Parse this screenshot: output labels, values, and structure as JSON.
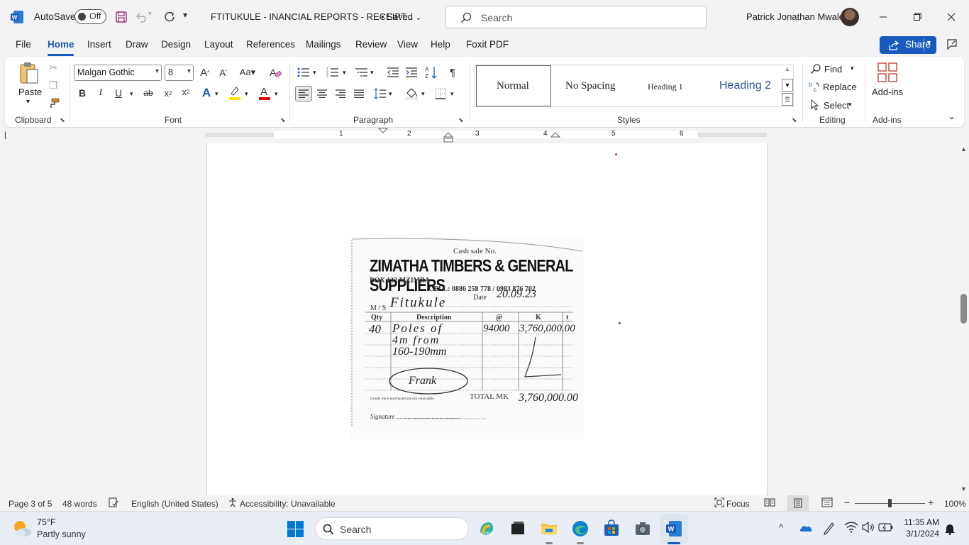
{
  "titlebar": {
    "autosave_label": "AutoSave",
    "autosave_state": "Off",
    "doc_title": "FTITUKULE - INANCIAL REPORTS - RECEIPT...",
    "saved_status": "• Saved",
    "search_placeholder": "Search",
    "user_name": "Patrick Jonathan Mwale"
  },
  "menu": {
    "tabs": [
      "File",
      "Home",
      "Insert",
      "Draw",
      "Design",
      "Layout",
      "References",
      "Mailings",
      "Review",
      "View",
      "Help",
      "Foxit PDF"
    ],
    "active_tab": "Home",
    "share_label": "Share"
  },
  "ribbon": {
    "clipboard": {
      "paste_label": "Paste",
      "group_label": "Clipboard"
    },
    "font": {
      "font_name": "Malgan Gothic",
      "font_size": "8",
      "group_label": "Font",
      "bold": "B",
      "italic": "I",
      "underline": "U",
      "strike": "ab"
    },
    "paragraph": {
      "group_label": "Paragraph"
    },
    "styles": {
      "items": [
        "Normal",
        "No Spacing",
        "Heading 1",
        "Heading 2"
      ],
      "selected": "Normal",
      "group_label": "Styles"
    },
    "editing": {
      "find": "Find",
      "replace": "Replace",
      "select": "Select",
      "group_label": "Editing"
    },
    "addins": {
      "label": "Add-ins",
      "group_label": "Add-ins"
    }
  },
  "ruler": {
    "numbers": [
      "1",
      "2",
      "3",
      "4",
      "5",
      "6"
    ]
  },
  "receipt": {
    "cash_sale": "Cash sale  No.",
    "company": "ZIMATHA TIMBERS & GENERAL SUPPLIERS",
    "box": "BOX 132 MZIMBA",
    "cell": "CELL: 0886 258 778 / 0983 876 702",
    "date_label": "Date",
    "date_value": "20.09.23",
    "ms_label": "M / S",
    "ms_value": "Fitukule",
    "columns": [
      "Qty",
      "Description",
      "@",
      "K",
      "t"
    ],
    "row_qty": "40",
    "row_desc": [
      "Poles of",
      "4m from",
      "160-190mm"
    ],
    "row_rate": "94000",
    "row_amount": "3,760,000.00",
    "stamp": "Frank",
    "footnote": "Goods once purchased are not returnable",
    "total_label": "TOTAL MK",
    "total_value": "3,760,000.00",
    "signature": "Signature ........................................"
  },
  "statusbar": {
    "page": "Page 3 of 5",
    "words": "48 words",
    "language": "English (United States)",
    "accessibility": "Accessibility: Unavailable",
    "focus": "Focus",
    "zoom": "100%"
  },
  "taskbar": {
    "weather_temp": "75°F",
    "weather_cond": "Partly sunny",
    "search_placeholder": "Search",
    "time": "11:35 AM",
    "date": "3/1/2024"
  }
}
